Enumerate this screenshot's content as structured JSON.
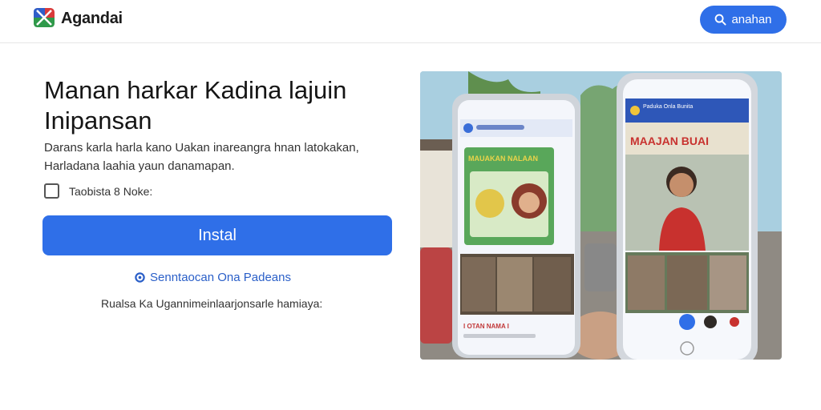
{
  "header": {
    "brand": "Agandai",
    "button_label": "anahan",
    "icons": {
      "logo": "flag-logo-icon",
      "button": "search-icon"
    }
  },
  "main": {
    "headline": "Manan harkar Kadina lajuin Inipansan",
    "description": "Darans karla harla kano Uakan inareangra hnan latokakan, Harladana laahia yaun danamapan.",
    "checkbox_label": "Taobista 8 Noke:",
    "install_label": "Instal",
    "link_label": "Senntaocan Ona Padeans",
    "footnote": "Rualsa Ka Ugannimeinlaarjonsarle hamiaya:"
  },
  "hero": {
    "left_phone": {
      "banner": "MAUAKAN NALAAN",
      "caption": "I OTAN NAMA I"
    },
    "right_phone": {
      "title": "Paduka Onla Bunita",
      "banner": "MAAJAN BUAI"
    }
  },
  "colors": {
    "accent": "#2f6fe8",
    "link": "#2a5fc8"
  }
}
